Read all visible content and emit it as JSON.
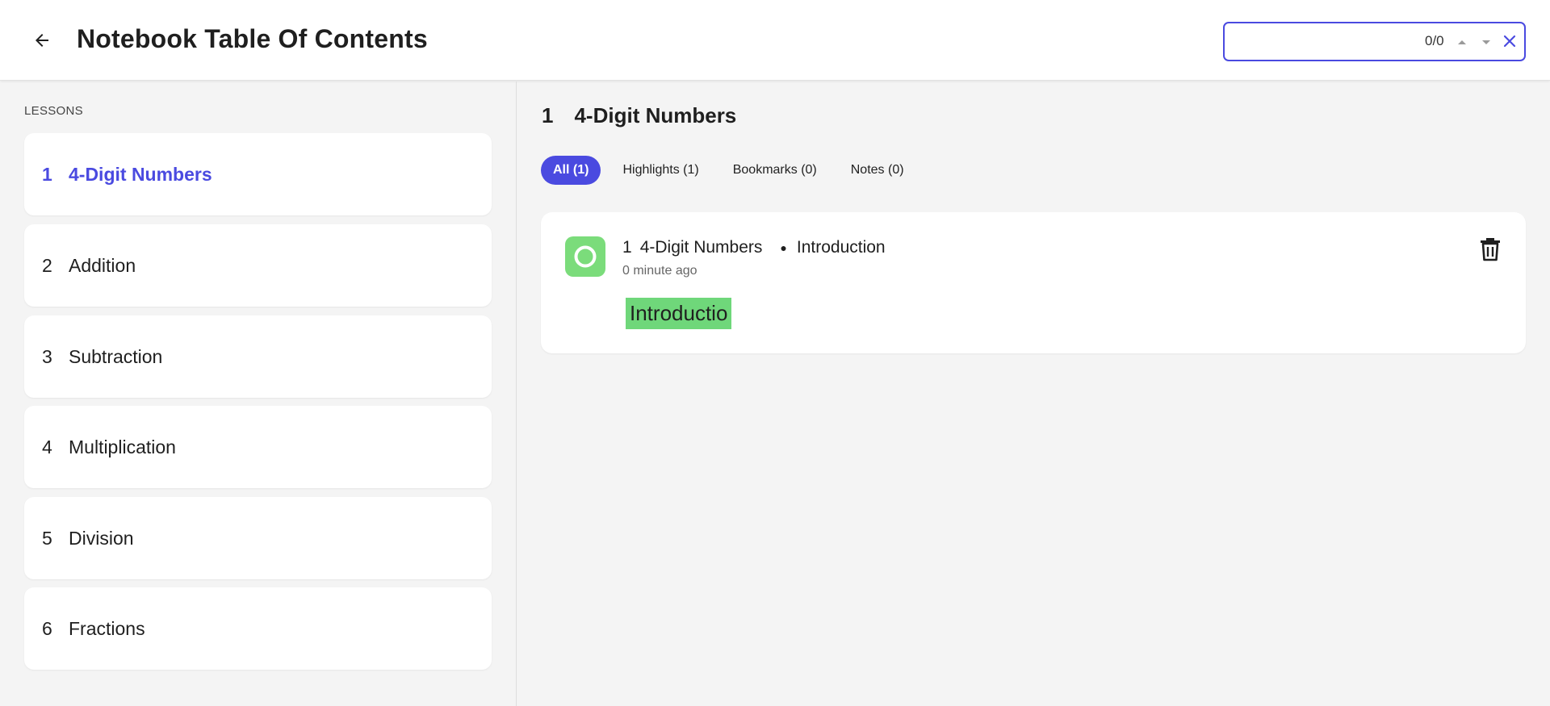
{
  "header": {
    "title": "Notebook Table Of Contents",
    "back_icon": "arrow-left-icon",
    "search": {
      "value": "",
      "count": "0/0"
    }
  },
  "sidebar": {
    "heading": "LESSONS",
    "lessons": [
      {
        "num": "1",
        "name": "4-Digit Numbers",
        "active": true
      },
      {
        "num": "2",
        "name": "Addition"
      },
      {
        "num": "3",
        "name": "Subtraction"
      },
      {
        "num": "4",
        "name": "Multiplication"
      },
      {
        "num": "5",
        "name": "Division"
      },
      {
        "num": "6",
        "name": "Fractions"
      }
    ]
  },
  "main": {
    "lesson_num": "1",
    "lesson_title": "4-Digit Numbers",
    "tabs": [
      {
        "label": "All (1)",
        "active": true
      },
      {
        "label": "Highlights (1)"
      },
      {
        "label": "Bookmarks (0)"
      },
      {
        "label": "Notes (0)"
      }
    ],
    "note": {
      "lesson_num": "1",
      "lesson_name": "4-Digit Numbers",
      "section": "Introduction",
      "time": "0 minute ago",
      "highlight_text": "Introductio",
      "highlight_color": "#6fd77a"
    }
  },
  "colors": {
    "accent": "#4a4ae0",
    "highlight": "#6fd77a"
  }
}
